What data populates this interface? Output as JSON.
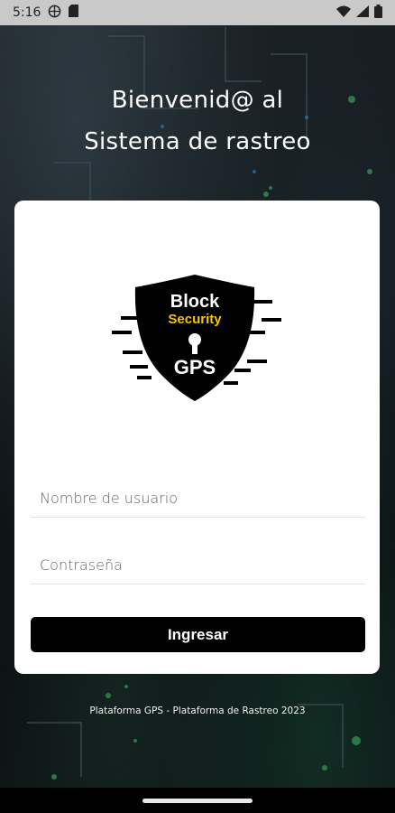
{
  "status_bar": {
    "time": "5:16",
    "icons": [
      "world-icon",
      "sim-card-icon",
      "wifi-icon",
      "signal-icon",
      "battery-icon"
    ]
  },
  "welcome": {
    "line1": "Bienvenid@ al",
    "line2": "Sistema de rastreo"
  },
  "logo": {
    "word1": "Block",
    "word2": "Security",
    "word3": "GPS",
    "accent_color": "#f5c400"
  },
  "form": {
    "username_placeholder": "Nombre de usuario",
    "password_placeholder": "Contraseña",
    "submit_label": "Ingresar"
  },
  "footer": {
    "text": "Plataforma GPS - Plataforma de Rastreo 2023"
  },
  "colors": {
    "button_bg": "#000000",
    "card_bg": "#ffffff"
  }
}
